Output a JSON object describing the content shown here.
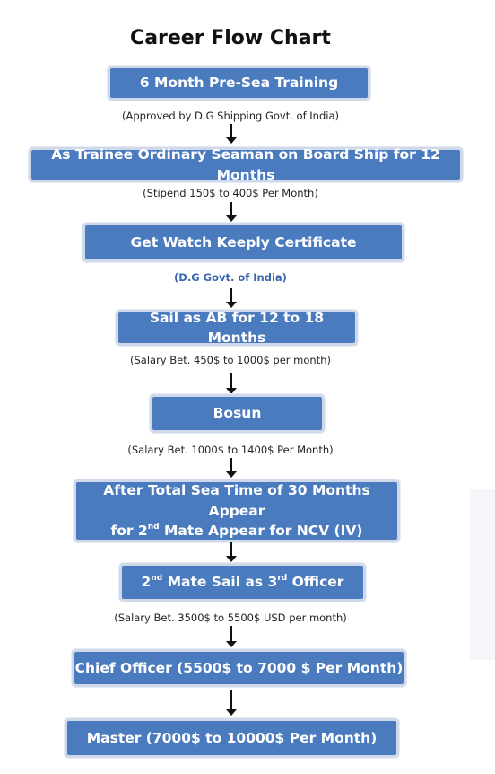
{
  "title": "Career Flow Chart",
  "steps": [
    {
      "label": "6 Month Pre-Sea Training",
      "note": "(Approved by D.G Shipping Govt. of India)"
    },
    {
      "label": "As Trainee Ordinary Seaman on Board Ship for 12 Months",
      "note": "(Stipend 150$ to 400$ Per Month)"
    },
    {
      "label": "Get Watch Keeply Certificate",
      "note": "(D.G Govt. of India)"
    },
    {
      "label": "Sail as AB for 12 to 18 Months",
      "note": "(Salary Bet. 450$ to 1000$  per month)"
    },
    {
      "label": "Bosun",
      "note": "(Salary Bet. 1000$ to 1400$  Per Month)"
    },
    {
      "label_line1": "After Total Sea Time of 30 Months Appear",
      "label_line2_pre": "for 2",
      "label_line2_sup": "nd",
      "label_line2_post": " Mate Appear for NCV (IV)"
    },
    {
      "label_pre": "2",
      "label_sup1": "nd",
      "label_mid": " Mate Sail as 3",
      "label_sup2": "rd",
      "label_post": " Officer",
      "note": "(Salary Bet. 3500$ to 5500$  USD per month)"
    },
    {
      "label": "Chief Officer (5500$ to 7000 $ Per Month)"
    },
    {
      "label": "Master (7000$ to 10000$ Per Month)"
    }
  ]
}
